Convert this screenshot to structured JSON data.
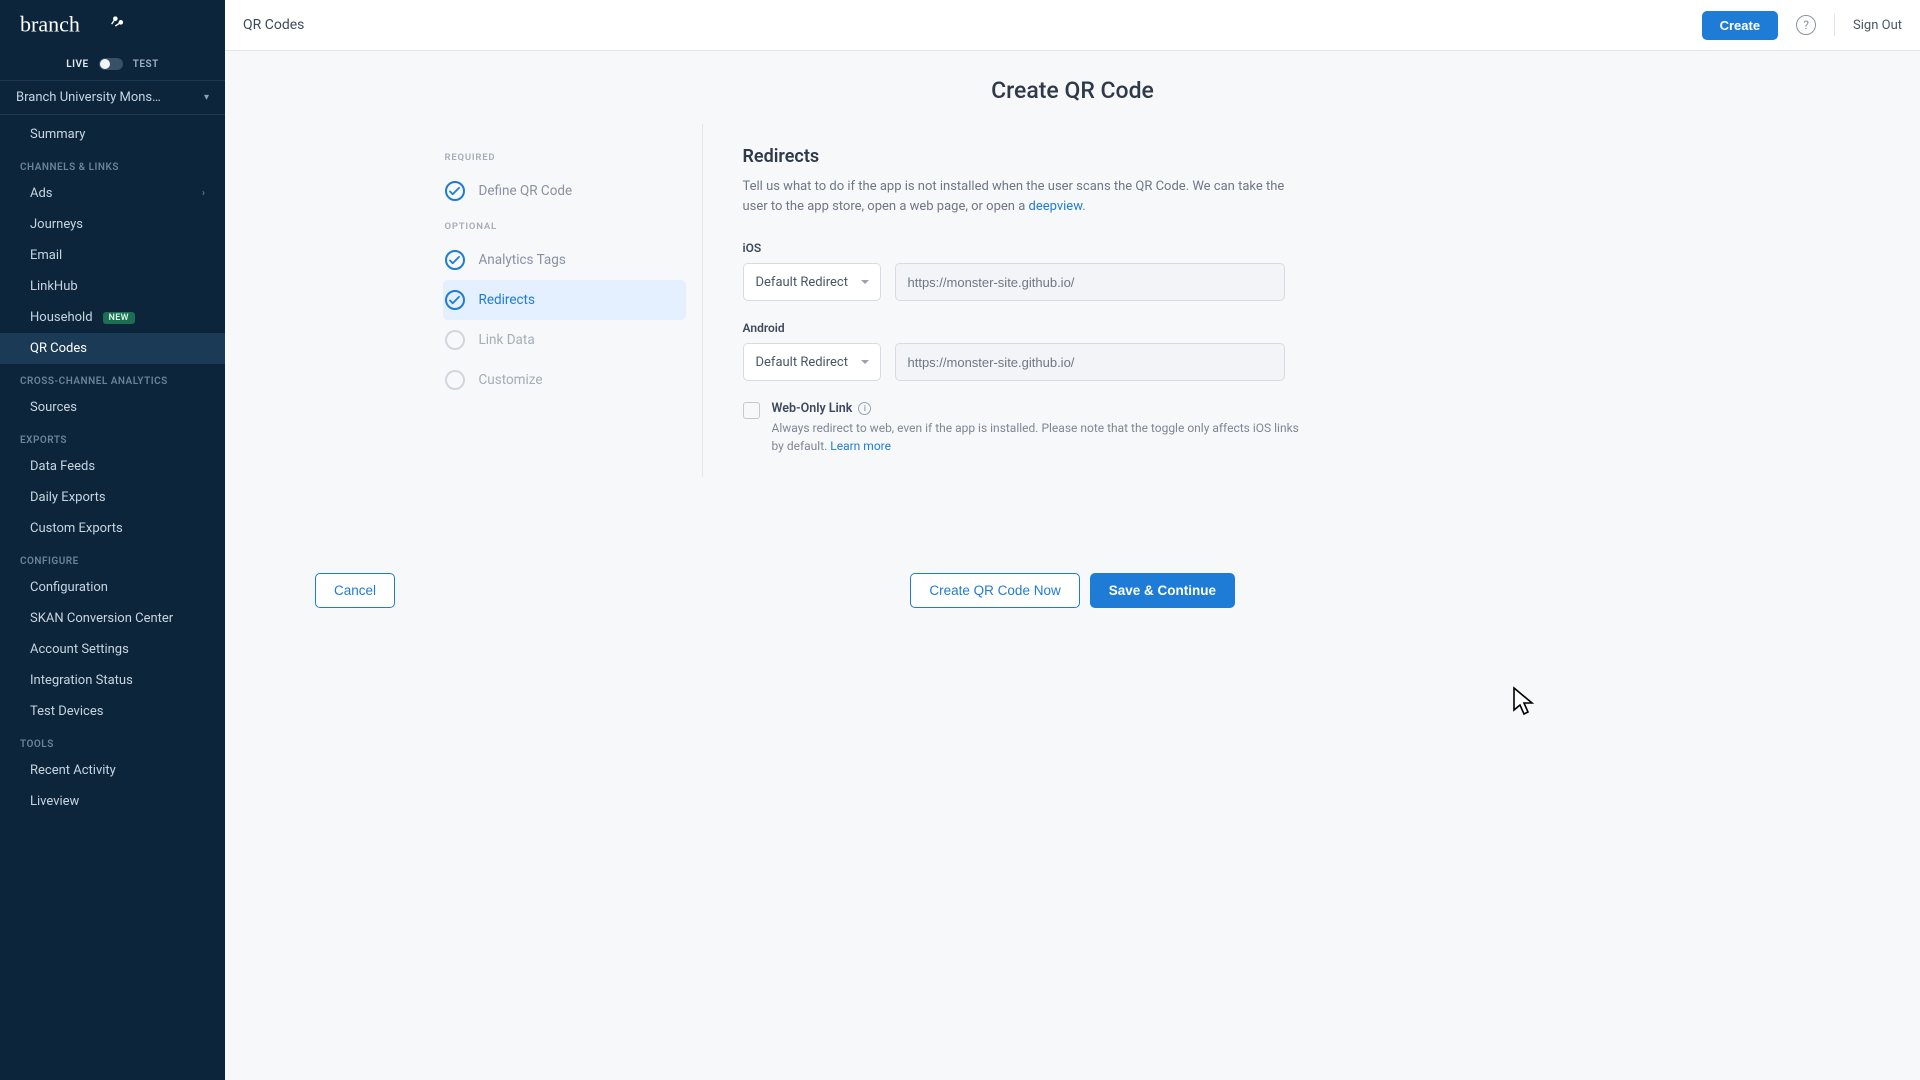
{
  "brand": "branch",
  "env": {
    "live": "LIVE",
    "test": "TEST"
  },
  "orgName": "Branch University Mons…",
  "topbar": {
    "title": "QR Codes",
    "createBtn": "Create",
    "signOut": "Sign Out"
  },
  "sidebar": {
    "summary": "Summary",
    "sections": {
      "channels": "CHANNELS & LINKS",
      "analytics": "CROSS-CHANNEL ANALYTICS",
      "exports": "EXPORTS",
      "configure": "CONFIGURE",
      "tools": "TOOLS"
    },
    "items": {
      "ads": "Ads",
      "journeys": "Journeys",
      "email": "Email",
      "linkhub": "LinkHub",
      "household": "Household",
      "householdBadge": "NEW",
      "qrcodes": "QR Codes",
      "sources": "Sources",
      "datafeeds": "Data Feeds",
      "daily": "Daily Exports",
      "custom": "Custom Exports",
      "configuration": "Configuration",
      "skan": "SKAN Conversion Center",
      "account": "Account Settings",
      "integration": "Integration Status",
      "testdev": "Test Devices",
      "recent": "Recent Activity",
      "liveview": "Liveview"
    }
  },
  "page": {
    "title": "Create QR Code"
  },
  "steps": {
    "required": "REQUIRED",
    "optional": "OPTIONAL",
    "define": "Define QR Code",
    "analytics": "Analytics Tags",
    "redirects": "Redirects",
    "linkdata": "Link Data",
    "customize": "Customize"
  },
  "form": {
    "heading": "Redirects",
    "descPre": "Tell us what to do if the app is not installed when the user scans the QR Code. We can take the user to the app store, open a web page, or open a ",
    "deepview": "deepview",
    "ios": "iOS",
    "android": "Android",
    "defaultRedirect": "Default Redirect",
    "urlValue": "https://monster-site.github.io/",
    "webOnly": "Web-Only Link",
    "webOnlyDesc": "Always redirect to web, even if the app is installed. Please note that the toggle only affects iOS links by default. ",
    "learnMore": "Learn more"
  },
  "buttons": {
    "cancel": "Cancel",
    "createNow": "Create QR Code Now",
    "save": "Save & Continue"
  }
}
